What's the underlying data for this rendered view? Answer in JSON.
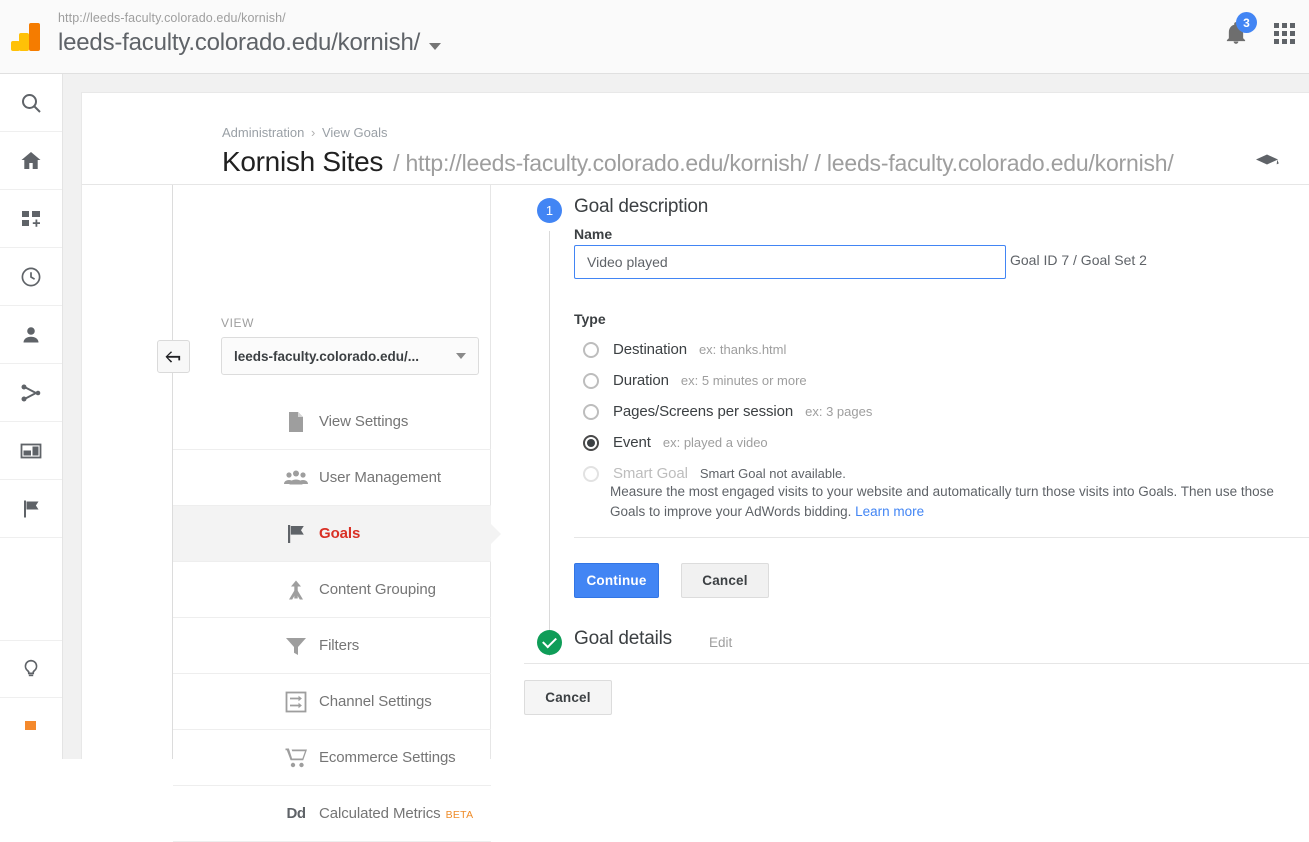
{
  "topbar": {
    "logo_icon": "google-analytics-logo",
    "account_url": "http://leeds-faculty.colorado.edu/kornish/",
    "account_name": "leeds-faculty.colorado.edu/kornish/",
    "dropdown_icon": "caret-down-icon",
    "notifications_icon": "bell-icon",
    "notifications_count": "3",
    "apps_icon": "apps-grid-icon"
  },
  "rail": {
    "items": [
      {
        "icon": "search-icon"
      },
      {
        "icon": "home-icon"
      },
      {
        "icon": "customization-add-icon"
      },
      {
        "icon": "realtime-clock-icon"
      },
      {
        "icon": "audience-person-icon"
      },
      {
        "icon": "acquisition-share-icon"
      },
      {
        "icon": "behavior-browser-icon"
      },
      {
        "icon": "conversions-flag-icon"
      }
    ],
    "bottom": [
      {
        "icon": "lightbulb-icon"
      },
      {
        "icon": "orange-square-icon"
      }
    ]
  },
  "header": {
    "breadcrumb": {
      "root": "Administration",
      "separator": "›",
      "current": "View Goals"
    },
    "title_main": "Kornish Sites",
    "title_path": "/ http://leeds-faculty.colorado.edu/kornish/ / leeds-faculty.colorado.edu/kornish/",
    "academy_icon": "graduation-cap-icon"
  },
  "admin": {
    "back_icon": "back-arrow-icon",
    "view_label": "VIEW",
    "view_selected": "leeds-faculty.colorado.edu/...",
    "view_caret_icon": "caret-down-icon",
    "menu": [
      {
        "label": "View Settings",
        "icon": "document-icon",
        "active": false,
        "beta": ""
      },
      {
        "label": "User Management",
        "icon": "people-icon",
        "active": false,
        "beta": ""
      },
      {
        "label": "Goals",
        "icon": "flag-icon",
        "active": true,
        "beta": ""
      },
      {
        "label": "Content Grouping",
        "icon": "content-grouping-icon",
        "active": false,
        "beta": ""
      },
      {
        "label": "Filters",
        "icon": "funnel-icon",
        "active": false,
        "beta": ""
      },
      {
        "label": "Channel Settings",
        "icon": "channel-icon",
        "active": false,
        "beta": ""
      },
      {
        "label": "Ecommerce Settings",
        "icon": "shopping-cart-icon",
        "active": false,
        "beta": ""
      },
      {
        "label": "Calculated Metrics",
        "icon": "dd-metrics-icon",
        "active": false,
        "beta": "BETA"
      }
    ]
  },
  "form": {
    "step1_number": "1",
    "step1_title": "Goal description",
    "name_label": "Name",
    "name_value": "Video played",
    "name_placeholder": "",
    "goal_id_text": "Goal ID 7 / Goal Set 2",
    "type_label": "Type",
    "types": [
      {
        "label": "Destination",
        "example": "ex: thanks.html",
        "checked": false,
        "disabled": false
      },
      {
        "label": "Duration",
        "example": "ex: 5 minutes or more",
        "checked": false,
        "disabled": false
      },
      {
        "label": "Pages/Screens per session",
        "example": "ex: 3 pages",
        "checked": false,
        "disabled": false
      },
      {
        "label": "Event",
        "example": "ex: played a video",
        "checked": true,
        "disabled": false
      },
      {
        "label": "Smart Goal",
        "example": "Smart Goal not available.",
        "checked": false,
        "disabled": true
      }
    ],
    "smart_goal_description": "Measure the most engaged visits to your website and automatically turn those visits into Goals. Then use those Goals to improve your AdWords bidding.",
    "learn_more": "Learn more",
    "continue_label": "Continue",
    "cancel_label": "Cancel",
    "step2_title": "Goal details",
    "step2_edit": "Edit",
    "bottom_cancel_label": "Cancel"
  },
  "colors": {
    "accent_blue": "#4285f4",
    "active_red": "#d93025",
    "success_green": "#0f9d58",
    "beta_orange": "#ef8c29"
  }
}
